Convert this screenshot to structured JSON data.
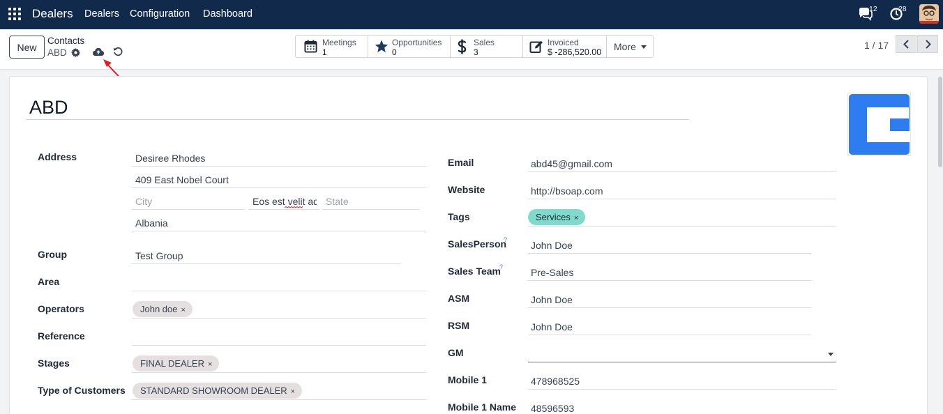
{
  "navbar": {
    "brand": "Dealers",
    "menu": [
      "Dealers",
      "Configuration",
      "Dashboard"
    ],
    "messages_count": "12",
    "activities_count": "28"
  },
  "control": {
    "new_label": "New",
    "breadcrumb_title": "Contacts",
    "record_name": "ABD",
    "smart_buttons": [
      {
        "label": "Meetings",
        "value": "1"
      },
      {
        "label": "Opportunities",
        "value": "0"
      },
      {
        "label": "Sales",
        "value": "3"
      },
      {
        "label": "Invoiced",
        "value": "$ -286,520.00"
      }
    ],
    "more_label": "More",
    "pager": "1 / 17"
  },
  "record": {
    "name": "ABD",
    "address": {
      "label": "Address",
      "street": "Desiree Rhodes",
      "street2": "409 East Nobel Court",
      "city_placeholder": "City",
      "zip": "Eos est velit ad",
      "state_placeholder": "State",
      "country": "Albania"
    },
    "left_fields": {
      "group_label": "Group",
      "group_value": "Test Group",
      "area_label": "Area",
      "operators_label": "Operators",
      "operators_tag": "John doe",
      "reference_label": "Reference",
      "stages_label": "Stages",
      "stages_tag": "FINAL DEALER",
      "customer_type_label": "Type of Customers",
      "customer_type_tag": "STANDARD SHOWROOM DEALER"
    },
    "right_fields": {
      "email_label": "Email",
      "email_value": "abd45@gmail.com",
      "website_label": "Website",
      "website_value": "http://bsoap.com",
      "tags_label": "Tags",
      "tags_tag": "Services",
      "salesperson_label": "SalesPerson",
      "salesperson_value": "John Doe",
      "sales_team_label": "Sales Team",
      "sales_team_value": "Pre-Sales",
      "asm_label": "ASM",
      "asm_value": "John Doe",
      "rsm_label": "RSM",
      "rsm_value": "John Doe",
      "gm_label": "GM",
      "mobile1_label": "Mobile 1",
      "mobile1_value": "478968525",
      "mobile1_name_label": "Mobile 1 Name",
      "mobile1_name_value": "48596593"
    },
    "help_mark": "?",
    "tag_remove": "×"
  },
  "colors": {
    "navbar": "#112a4c",
    "tag_teal": "#7fd9cd",
    "tag_grey": "#e5dfdf",
    "arrow": "#e11d24",
    "logo_blue": "#2d7cf0"
  }
}
